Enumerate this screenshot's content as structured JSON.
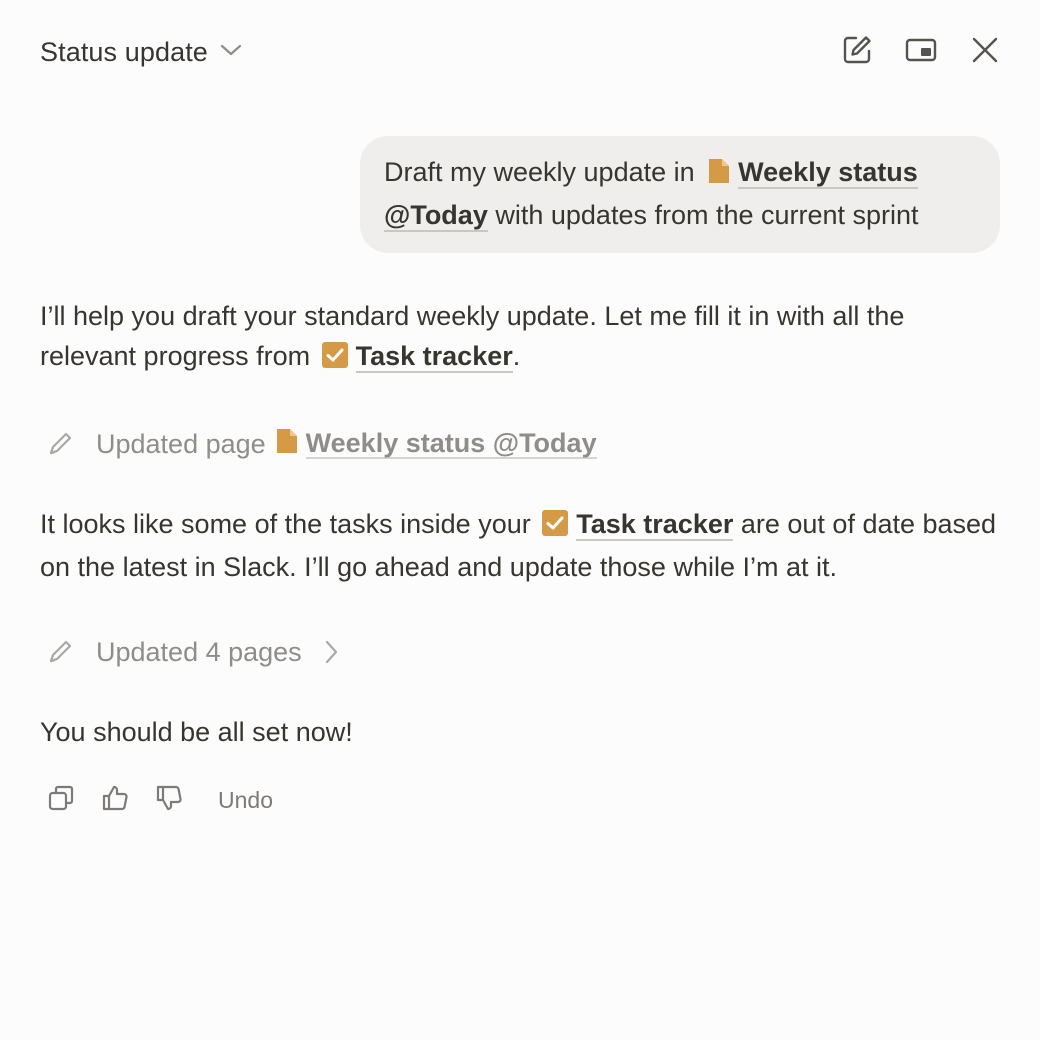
{
  "header": {
    "title": "Status update",
    "icons": [
      "chevron-down-icon",
      "new-chat-icon",
      "picture-in-picture-icon",
      "close-icon"
    ]
  },
  "user_message": {
    "prefix": "Draft my weekly update in",
    "page_mention": "Weekly status @Today",
    "suffix": "with updates from the current sprint"
  },
  "assistant": {
    "intro_prefix": "I’ll help you draft your standard weekly update. Let me fill it in with all the relevant progress from",
    "intro_mention": "Task tracker",
    "intro_suffix": ".",
    "action1_label": "Updated page",
    "action1_mention": "Weekly status @Today",
    "body_prefix": "It looks like some of the tasks inside your",
    "body_mention": "Task tracker",
    "body_suffix": "are out of date based on the latest in Slack. I’ll go ahead and update those while I’m at it.",
    "action2_label": "Updated 4 pages",
    "closing": "You should be all set now!"
  },
  "feedback": {
    "undo_label": "Undo",
    "icons": [
      "copy-icon",
      "thumbs-up-icon",
      "thumbs-down-icon"
    ]
  },
  "colors": {
    "background": "#fdfcfc",
    "bubble": "#efeeec",
    "text": "#37352f",
    "muted": "#8f8d89",
    "accent": "#d49a45"
  }
}
